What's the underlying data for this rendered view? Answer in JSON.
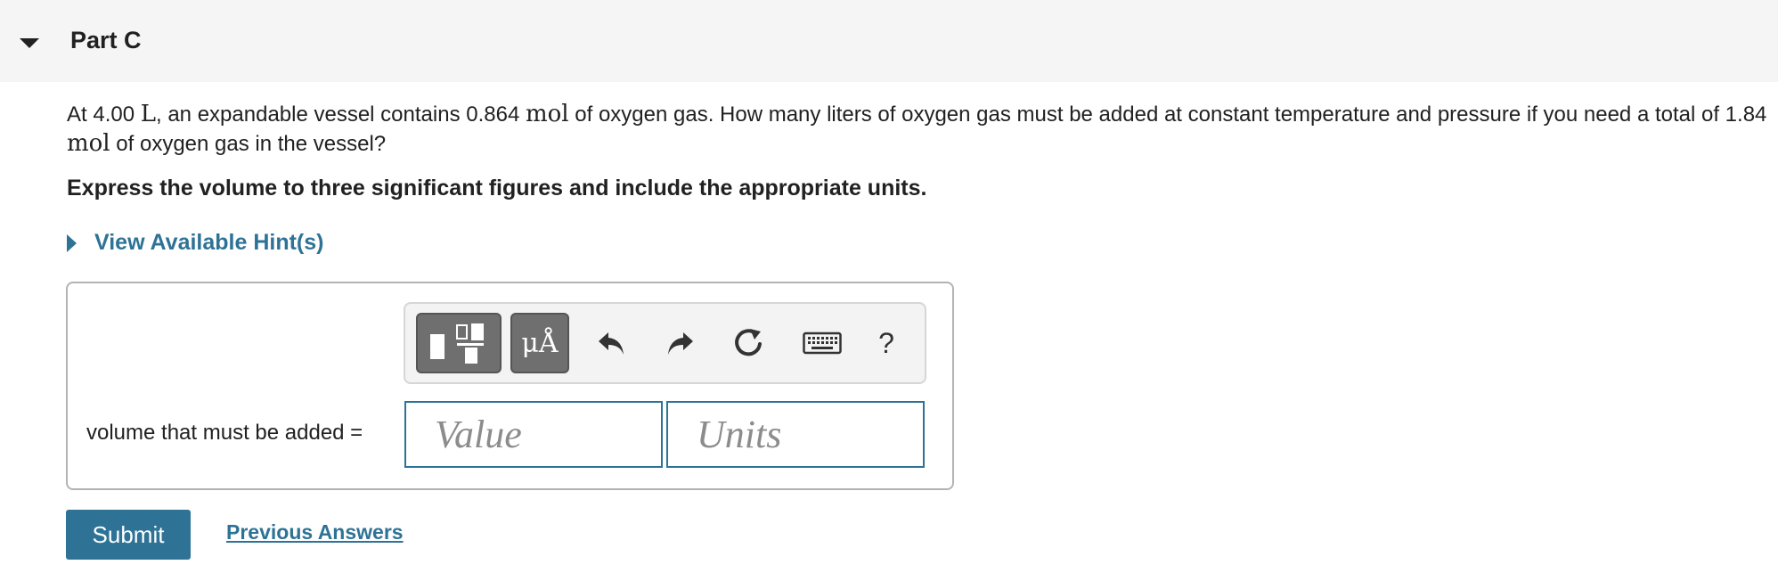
{
  "part": {
    "title": "Part C"
  },
  "question": {
    "seg1": "At 4.00 ",
    "unit1": "L",
    "seg2": ", an expandable vessel contains 0.864 ",
    "unit2": "mol",
    "seg3": " of oxygen gas. How many liters of oxygen gas must be added at constant temperature and pressure if you need a total of  1.84 ",
    "unit3": "mol",
    "seg4": " of oxygen gas in the vessel?"
  },
  "instruction": "Express the volume to three significant figures and include the appropriate units.",
  "hint": {
    "label": "View Available Hint(s)"
  },
  "toolbar": {
    "units_label": "μÅ",
    "help_label": "?"
  },
  "answer": {
    "label": "volume that must be added =",
    "value_placeholder": "Value",
    "units_placeholder": "Units",
    "value": "",
    "units": ""
  },
  "actions": {
    "submit_label": "Submit",
    "previous_answers_label": "Previous Answers"
  },
  "colors": {
    "accent": "#2e7396",
    "header_bg": "#f5f5f5",
    "tool_dark": "#6f6f6f"
  },
  "icons": {
    "collapse": "caret-down-icon",
    "hint": "caret-right-icon",
    "templates": "templates-icon",
    "undo": "undo-icon",
    "redo": "redo-icon",
    "reset": "reset-icon",
    "keyboard": "keyboard-icon",
    "help": "help-icon"
  }
}
